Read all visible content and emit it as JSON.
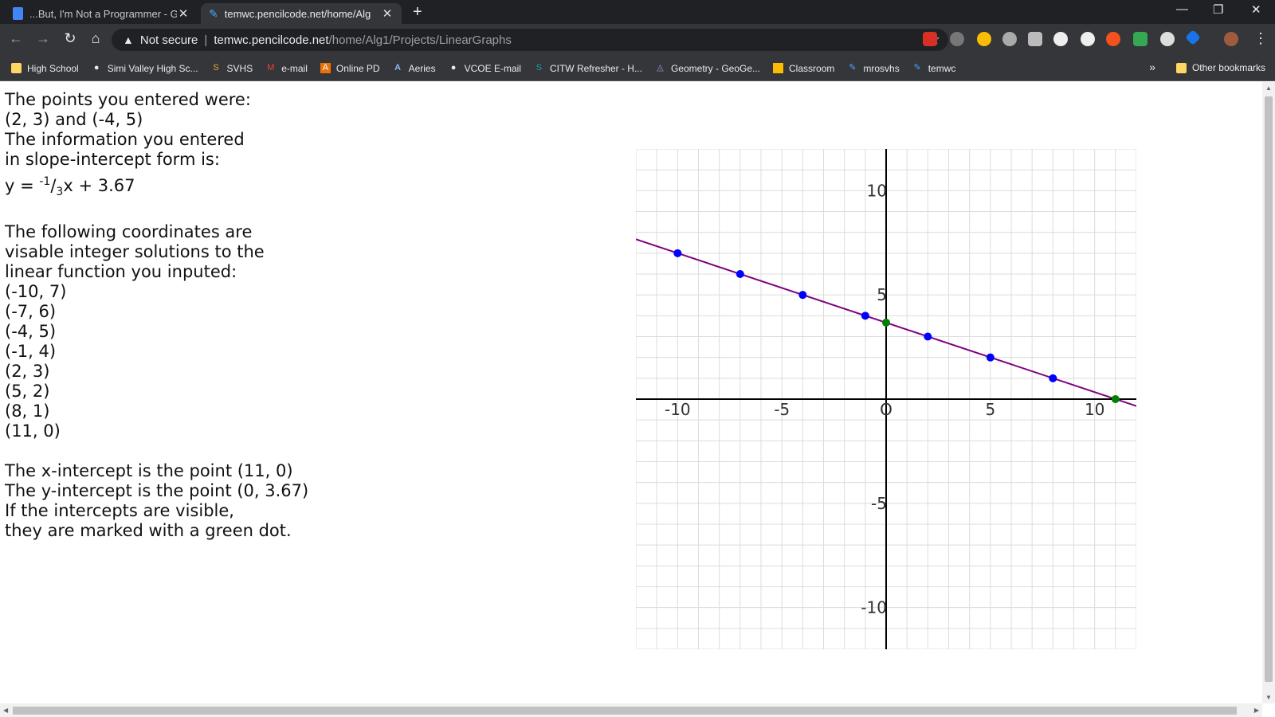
{
  "browser": {
    "tabs": [
      {
        "title": "...But, I'm Not a Programmer - Go",
        "active": false,
        "icon": "docs-icon"
      },
      {
        "title": "temwc.pencilcode.net/home/Alg",
        "active": true,
        "icon": "pencil-icon"
      }
    ],
    "new_tab": "+",
    "address": {
      "security": "Not secure",
      "host": "temwc.pencilcode.net",
      "path": "/home/Alg1/Projects/LinearGraphs"
    },
    "bookmarks": [
      {
        "label": "High School",
        "icon": "folder-icon"
      },
      {
        "label": "Simi Valley High Sc...",
        "icon": "globe-icon"
      },
      {
        "label": "SVHS",
        "icon": "s-icon"
      },
      {
        "label": "e-mail",
        "icon": "gmail-icon"
      },
      {
        "label": "Online PD",
        "icon": "adobe-icon"
      },
      {
        "label": "Aeries",
        "icon": "aeries-icon"
      },
      {
        "label": "VCOE E-mail",
        "icon": "globe-icon"
      },
      {
        "label": "CITW Refresher - H...",
        "icon": "sp-icon"
      },
      {
        "label": "Geometry - GeoGe...",
        "icon": "geogebra-icon"
      },
      {
        "label": "Classroom",
        "icon": "classroom-icon"
      },
      {
        "label": "mrosvhs",
        "icon": "pencil-icon"
      },
      {
        "label": "temwc",
        "icon": "pencil-icon"
      }
    ],
    "overflow": "»",
    "other_bookmarks": "Other bookmarks"
  },
  "page": {
    "lines_top": [
      "The points you entered were:",
      "(2, 3) and (-4, 5)",
      "The information you entered",
      "in slope-intercept form is:"
    ],
    "equation": {
      "prefix": "y = ",
      "num": "-1",
      "den": "3",
      "suffix": "x + 3.67"
    },
    "lines_mid": [
      "The following coordinates are",
      "visable integer solutions to the",
      "linear function you inputed:"
    ],
    "solutions": [
      "(-10, 7)",
      "(-7, 6)",
      "(-4, 5)",
      "(-1, 4)",
      "(2, 3)",
      "(5, 2)",
      "(8, 1)",
      "(11, 0)"
    ],
    "lines_bottom": [
      "The x-intercept is the point (11, 0)",
      "The y-intercept is the point (0, 3.67)",
      "If the intercepts are visible,",
      "they are marked with a green dot."
    ]
  },
  "chart_data": {
    "type": "line",
    "xlim": [
      -12,
      12
    ],
    "ylim": [
      -12,
      12
    ],
    "grid": true,
    "x_tick_labels": [
      {
        "value": -10,
        "label": "-10"
      },
      {
        "value": -5,
        "label": "-5"
      },
      {
        "value": 0,
        "label": "O"
      },
      {
        "value": 5,
        "label": "5"
      },
      {
        "value": 10,
        "label": "10"
      }
    ],
    "y_tick_labels": [
      {
        "value": 10,
        "label": "10"
      },
      {
        "value": 5,
        "label": "5"
      },
      {
        "value": -5,
        "label": "-5"
      },
      {
        "value": -10,
        "label": "-10"
      }
    ],
    "line": {
      "slope": -0.3333,
      "intercept": 3.67,
      "color": "#800080"
    },
    "points": [
      {
        "x": -10,
        "y": 7,
        "color": "#0000ff"
      },
      {
        "x": -7,
        "y": 6,
        "color": "#0000ff"
      },
      {
        "x": -4,
        "y": 5,
        "color": "#0000ff"
      },
      {
        "x": -1,
        "y": 4,
        "color": "#0000ff"
      },
      {
        "x": 0,
        "y": 3.67,
        "color": "#008000"
      },
      {
        "x": 2,
        "y": 3,
        "color": "#0000ff"
      },
      {
        "x": 5,
        "y": 2,
        "color": "#0000ff"
      },
      {
        "x": 8,
        "y": 1,
        "color": "#0000ff"
      },
      {
        "x": 11,
        "y": 0,
        "color": "#008000"
      }
    ]
  }
}
